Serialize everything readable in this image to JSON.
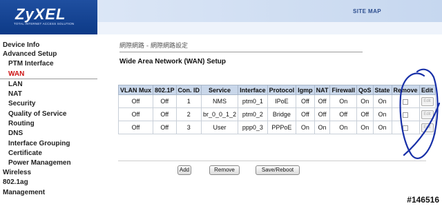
{
  "header": {
    "logo": "ZyXEL",
    "tagline": "TOTAL INTERNET ACCESS SOLUTION",
    "site_map": "SITE MAP",
    "colors": {
      "logo_bg": "#0d3a87",
      "bar_bg": "#c6d7ef"
    }
  },
  "sidebar": {
    "items": [
      {
        "label": "Device Info"
      },
      {
        "label": "Advanced Setup"
      },
      {
        "label": "PTM Interface"
      },
      {
        "label": "WAN"
      },
      {
        "label": "LAN"
      },
      {
        "label": "NAT"
      },
      {
        "label": "Security"
      },
      {
        "label": "Quality of Service"
      },
      {
        "label": "Routing"
      },
      {
        "label": "DNS"
      },
      {
        "label": "Interface Grouping"
      },
      {
        "label": "Certificate"
      },
      {
        "label": "Power Managemen"
      },
      {
        "label": "Wireless"
      },
      {
        "label": "802.1ag"
      },
      {
        "label": "Management"
      }
    ],
    "active": "WAN"
  },
  "main": {
    "breadcrumb": "網際網路 - 網際網路設定",
    "title": "Wide Area Network (WAN) Setup",
    "table": {
      "headers": [
        "VLAN Mux",
        "802.1P",
        "Con. ID",
        "Service",
        "Interface",
        "Protocol",
        "Igmp",
        "NAT",
        "Firewall",
        "QoS",
        "State",
        "Remove",
        "Edit"
      ],
      "rows": [
        [
          "Off",
          "Off",
          "1",
          "NMS",
          "ptm0_1",
          "IPoE",
          "Off",
          "Off",
          "On",
          "On",
          "On"
        ],
        [
          "Off",
          "Off",
          "2",
          "br_0_0_1_2",
          "ptm0_2",
          "Bridge",
          "Off",
          "Off",
          "Off",
          "Off",
          "On"
        ],
        [
          "Off",
          "Off",
          "3",
          "User",
          "ppp0_3",
          "PPPoE",
          "On",
          "On",
          "On",
          "On",
          "On"
        ]
      ],
      "edit_label": "Edit"
    },
    "buttons": {
      "add": "Add",
      "remove": "Remove",
      "save_reboot": "Save/Reboot"
    }
  },
  "watermark": "#146516"
}
